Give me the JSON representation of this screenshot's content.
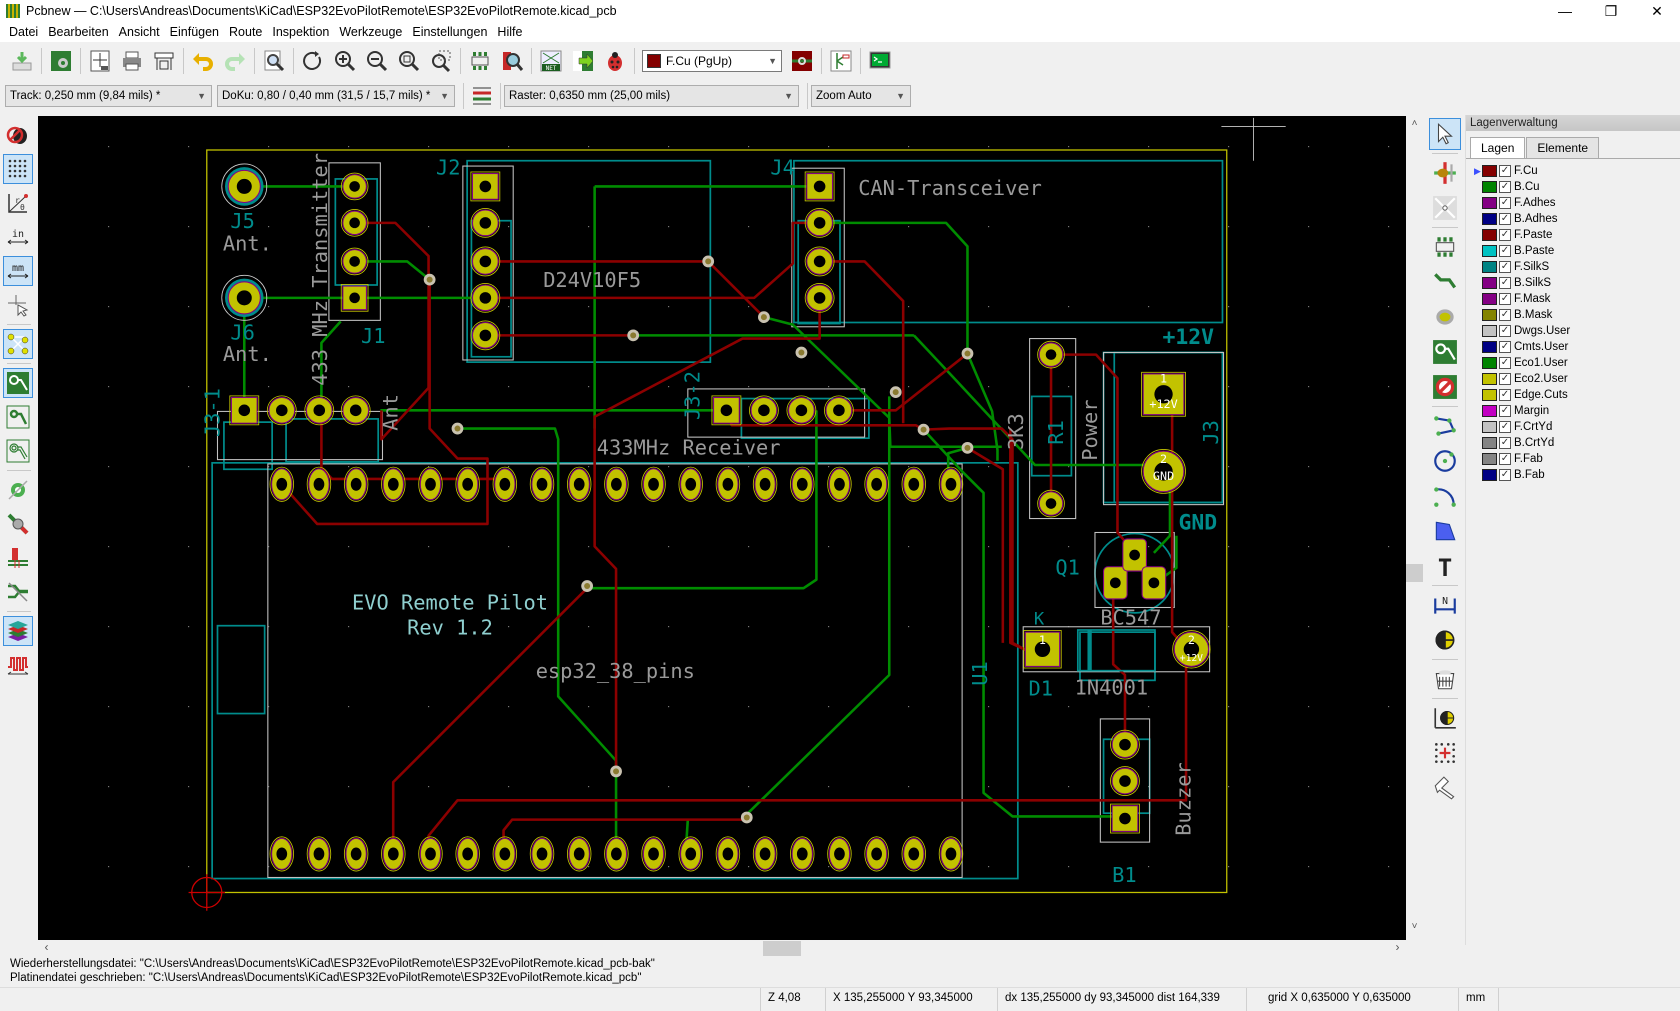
{
  "window": {
    "title": "Pcbnew — C:\\Users\\Andreas\\Documents\\KiCad\\ESP32EvoPilotRemote\\ESP32EvoPilotRemote.kicad_pcb",
    "controls": {
      "minimize": "—",
      "maximize": "❐",
      "close": "✕"
    }
  },
  "menu": [
    "Datei",
    "Bearbeiten",
    "Ansicht",
    "Einfügen",
    "Route",
    "Inspektion",
    "Werkzeuge",
    "Einstellungen",
    "Hilfe"
  ],
  "toolbar": {
    "active_layer": "F.Cu (PgUp)",
    "active_layer_color": "#840000",
    "track": "Track: 0,250 mm (9,84 mils) *",
    "via": "DoKu: 0,80 / 0,40 mm (31,5 / 15,7 mils) *",
    "grid": "Raster: 0,6350 mm (25,00 mils)",
    "zoom": "Zoom Auto"
  },
  "layers_panel": {
    "caption": "Lagenverwaltung",
    "tabs": [
      "Lagen",
      "Elemente"
    ],
    "active_tab": "Lagen",
    "layers": [
      {
        "name": "F.Cu",
        "color": "#840000",
        "visible": true,
        "active": true
      },
      {
        "name": "B.Cu",
        "color": "#008400",
        "visible": true
      },
      {
        "name": "F.Adhes",
        "color": "#840084",
        "visible": true
      },
      {
        "name": "B.Adhes",
        "color": "#000084",
        "visible": true
      },
      {
        "name": "F.Paste",
        "color": "#840000",
        "visible": true
      },
      {
        "name": "B.Paste",
        "color": "#00c2c2",
        "visible": true
      },
      {
        "name": "F.SilkS",
        "color": "#008484",
        "visible": true
      },
      {
        "name": "B.SilkS",
        "color": "#840084",
        "visible": true
      },
      {
        "name": "F.Mask",
        "color": "#840084",
        "visible": true
      },
      {
        "name": "B.Mask",
        "color": "#848400",
        "visible": true
      },
      {
        "name": "Dwgs.User",
        "color": "#c2c2c2",
        "visible": true
      },
      {
        "name": "Cmts.User",
        "color": "#000084",
        "visible": true
      },
      {
        "name": "Eco1.User",
        "color": "#008400",
        "visible": true
      },
      {
        "name": "Eco2.User",
        "color": "#c2c200",
        "visible": true
      },
      {
        "name": "Edge.Cuts",
        "color": "#c2c200",
        "visible": true
      },
      {
        "name": "Margin",
        "color": "#c200c2",
        "visible": true
      },
      {
        "name": "F.CrtYd",
        "color": "#c2c2c2",
        "visible": true
      },
      {
        "name": "B.CrtYd",
        "color": "#848484",
        "visible": true
      },
      {
        "name": "F.Fab",
        "color": "#848484",
        "visible": true
      },
      {
        "name": "B.Fab",
        "color": "#000084",
        "visible": true
      }
    ]
  },
  "pcb": {
    "labels": {
      "j5_ref": "J5",
      "j5_val": "Ant.",
      "j6_ref": "J6",
      "j6_val": "Ant.",
      "j1_ref": "J1",
      "j1_val": "433 MHz Transmitter",
      "j2_ref": "J2",
      "j2_val": "D24V10F5",
      "j4_ref": "J4",
      "j4_val": "CAN-Transceiver",
      "j31_ref": "J3-1",
      "j31_val": "Ant",
      "j32_ref": "J3-2",
      "j32_val": "433MHz Receiver",
      "r1_ref": "R1",
      "r1_val": "3K3",
      "j3_ref": "J3",
      "j3_val": "Power",
      "j3_net1": "+12V",
      "j3_net2": "GND",
      "j3_pin1": "1",
      "j3_pin2": "2",
      "q1_ref": "Q1",
      "q1_val": "BC547",
      "d1_ref": "D1",
      "d1_val": "1N4001",
      "d1_k": "K",
      "d1_pin1": "1",
      "d1_pin2": "2",
      "d1_pin2_net": "+12V",
      "b1_ref": "B1",
      "b1_val": "Buzzer",
      "u1_ref": "U1",
      "u1_val": "esp32_38_pins",
      "board_title": "EVO Remote Pilot",
      "board_rev": "Rev 1.2"
    }
  },
  "messages": [
    "Wiederherstellungsdatei: \"C:\\Users\\Andreas\\Documents\\KiCad\\ESP32EvoPilotRemote\\ESP32EvoPilotRemote.kicad_pcb-bak\"",
    "Platinendatei geschrieben: \"C:\\Users\\Andreas\\Documents\\KiCad\\ESP32EvoPilotRemote\\ESP32EvoPilotRemote.kicad_pcb\""
  ],
  "status": {
    "zoom": "Z 4,08",
    "cursor": "X 135,255000  Y 93,345000",
    "delta": "dx 135,255000  dy 93,345000  dist 164,339",
    "grid": "grid X 0,635000  Y 0,635000",
    "units": "mm"
  }
}
